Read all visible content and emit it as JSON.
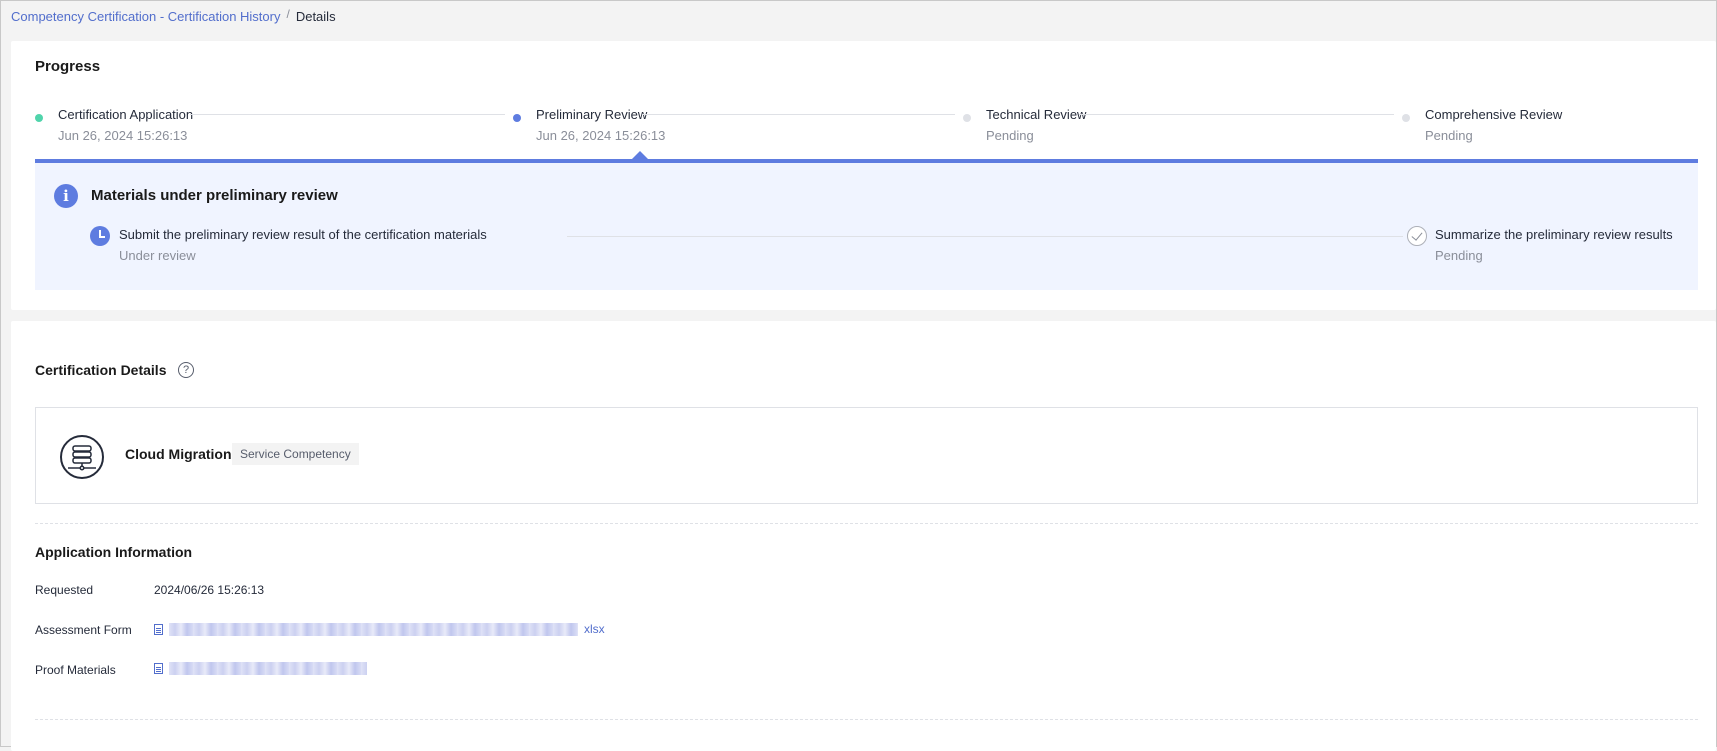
{
  "breadcrumb": {
    "parent": "Competency Certification - Certification History",
    "separator": "/",
    "current": "Details"
  },
  "progress": {
    "title": "Progress",
    "steps": [
      {
        "title": "Certification Application",
        "sub": "Jun 26, 2024 15:26:13",
        "state": "done",
        "color": "#50d4ab"
      },
      {
        "title": "Preliminary Review",
        "sub": "Jun 26, 2024 15:26:13",
        "state": "active",
        "color": "#5e7ce0"
      },
      {
        "title": "Technical Review",
        "sub": "Pending",
        "state": "pending",
        "color": "#dfe1e6"
      },
      {
        "title": "Comprehensive Review",
        "sub": "Pending",
        "state": "pending",
        "color": "#dfe1e6"
      }
    ],
    "panel": {
      "title": "Materials under preliminary review",
      "sub_steps": [
        {
          "title": "Submit the preliminary review result of the certification materials",
          "status": "Under review"
        },
        {
          "title": "Summarize the preliminary review results",
          "status": "Pending"
        }
      ]
    }
  },
  "details": {
    "title": "Certification Details",
    "help_icon": "?",
    "certification": {
      "name": "Cloud Migration",
      "tag": "Service Competency"
    },
    "application": {
      "title": "Application Information",
      "requested_label": "Requested",
      "requested_value": "2024/06/26 15:26:13",
      "assessment_label": "Assessment Form",
      "assessment_ext": "xlsx",
      "proof_label": "Proof Materials"
    }
  },
  "colors": {
    "accent": "#5e7ce0",
    "link": "#526ecc",
    "done": "#50d4ab"
  }
}
